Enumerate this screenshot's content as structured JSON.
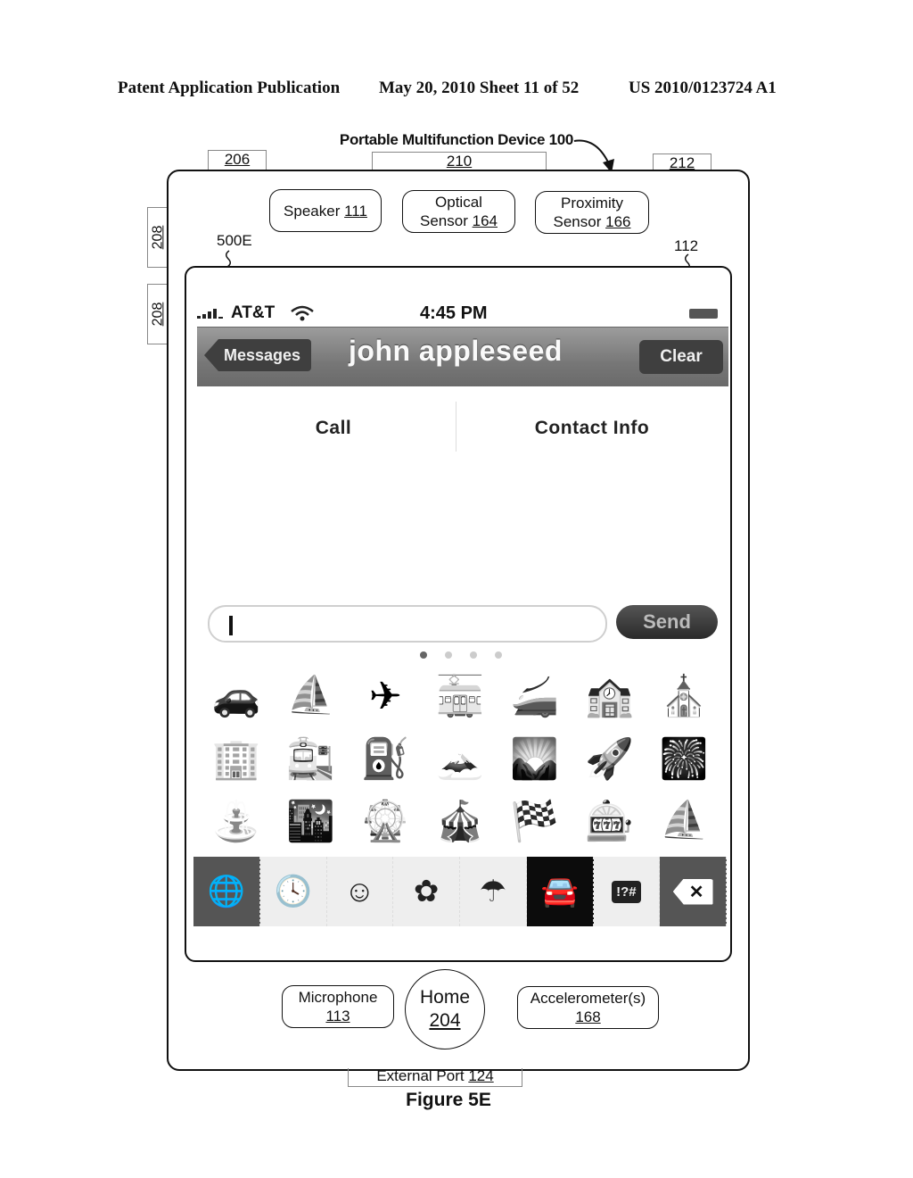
{
  "header": {
    "publication": "Patent Application Publication",
    "date_sheet": "May 20, 2010  Sheet 11 of 52",
    "pub_number": "US 2010/0123724 A1"
  },
  "device": {
    "title": "Portable Multifunction Device 100",
    "top_refs": [
      "206",
      "210",
      "212"
    ],
    "side_refs": [
      "208",
      "208"
    ],
    "sensors": [
      {
        "label": "Speaker",
        "ref": "111"
      },
      {
        "label": "Optical",
        "label2": "Sensor",
        "ref": "164"
      },
      {
        "label": "Proximity",
        "label2": "Sensor",
        "ref": "166"
      }
    ],
    "screen_ref": "500E",
    "touchscreen_ref": "112",
    "bottom": {
      "microphone": {
        "label": "Microphone",
        "ref": "113"
      },
      "home": {
        "label": "Home",
        "ref": "204"
      },
      "accelerometer": {
        "label": "Accelerometer(s)",
        "ref": "168"
      }
    },
    "external_port": {
      "label": "External Port",
      "ref": "124"
    },
    "figure": "Figure 5E"
  },
  "screen": {
    "status": {
      "carrier": "AT&T",
      "time": "4:45 PM",
      "signal_icon": "signal-bars",
      "wifi_icon": "wifi",
      "battery_icon": "battery"
    },
    "navbar": {
      "back_label": "Messages",
      "title": "john appleseed",
      "clear_label": "Clear"
    },
    "actions": {
      "call": "Call",
      "contact_info": "Contact Info"
    },
    "compose": {
      "input_value": "",
      "send_label": "Send"
    },
    "page_dots": {
      "count": 4,
      "active": 1
    },
    "emoji_rows": [
      [
        "🚗",
        "⛵",
        "✈",
        "🚋",
        "🚄",
        "🏫",
        "⛪"
      ],
      [
        "🏢",
        "🚉",
        "⛽",
        "🗻",
        "🌄",
        "🚀",
        "🎆"
      ],
      [
        "⛲",
        "🌃",
        "🎡",
        "🎪",
        "🏁",
        "🎰",
        "⛵"
      ]
    ],
    "emoji_names": [
      [
        "car",
        "sailboat",
        "airplane",
        "tram",
        "bullet-train",
        "school",
        "church"
      ],
      [
        "office-building",
        "train-station",
        "fuel-pump",
        "mountain",
        "sunrise",
        "rocket",
        "fireworks"
      ],
      [
        "fountain",
        "night-city",
        "ferris-wheel",
        "circus",
        "checkered-flag",
        "slot-machine",
        "sailboat"
      ]
    ],
    "keyboard_categories": [
      {
        "name": "globe",
        "glyph": "🌐",
        "style": "dark"
      },
      {
        "name": "recent-clock",
        "glyph": "🕓",
        "style": "light"
      },
      {
        "name": "smiley",
        "glyph": "☺",
        "style": "light"
      },
      {
        "name": "flower",
        "glyph": "✿",
        "style": "light"
      },
      {
        "name": "umbrella",
        "glyph": "☂",
        "style": "light"
      },
      {
        "name": "car",
        "glyph": "🚘",
        "style": "active"
      },
      {
        "name": "symbols",
        "glyph": "!?#",
        "style": "light"
      },
      {
        "name": "delete",
        "glyph": "✕",
        "style": "dark"
      }
    ]
  }
}
